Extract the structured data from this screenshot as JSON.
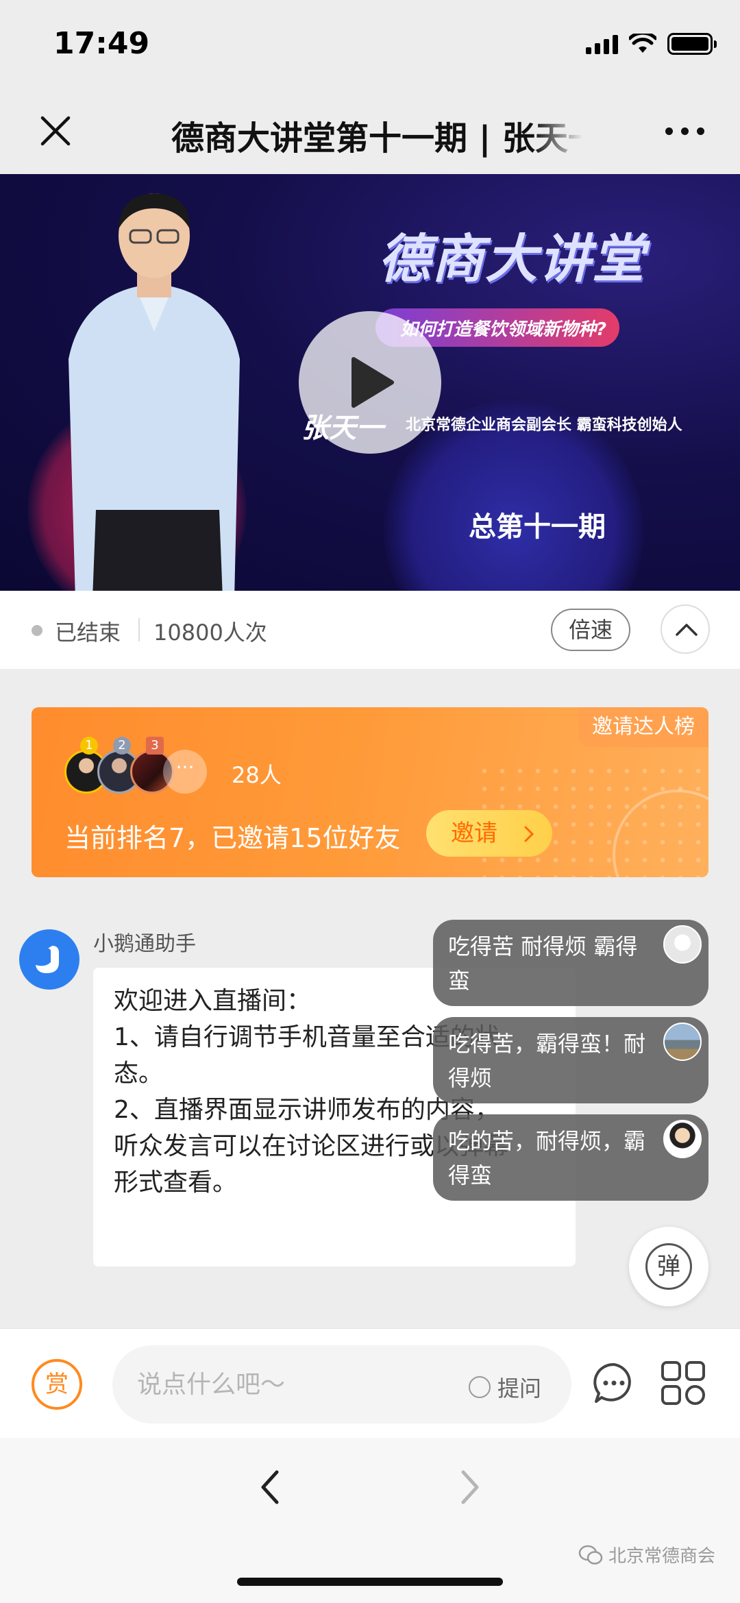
{
  "status_bar": {
    "time": "17:49"
  },
  "nav": {
    "title": "德商大讲堂第十一期 | 张天一"
  },
  "video": {
    "heading": "德商大讲堂",
    "subtitle": "如何打造餐饮领域新物种?",
    "signature": "张天一",
    "speaker_role": "北京常德企业商会副会长 霸蛮科技创始人",
    "issue": "总第十一期"
  },
  "info_bar": {
    "status": "已结束",
    "views": "10800人次",
    "speed_label": "倍速"
  },
  "invite": {
    "leaderboard_label": "邀请达人榜",
    "ranks": [
      "1",
      "2",
      "3"
    ],
    "more": "···",
    "count": "28人",
    "rank_text": "当前排名7，已邀请15位好友",
    "invite_button": "邀请"
  },
  "assistant": {
    "name": "小鹅通助手",
    "lines": [
      "欢迎进入直播间：",
      "1、请自行调节手机音量至合适的状",
      "态。",
      "2、直播界面显示讲师发布的内容，",
      "听众发言可以在讨论区进行或以弹幕",
      "形式查看。"
    ]
  },
  "danmu": [
    {
      "text": "吃得苦 耐得烦 霸得蛮"
    },
    {
      "text": "吃得苦，霸得蛮！耐得烦"
    },
    {
      "text": "吃的苦，耐得烦，霸得蛮"
    }
  ],
  "danmu_toggle": "弹",
  "input_bar": {
    "reward": "赏",
    "placeholder": "说点什么吧～",
    "ask_label": "提问"
  },
  "watermark": "北京常德商会"
}
